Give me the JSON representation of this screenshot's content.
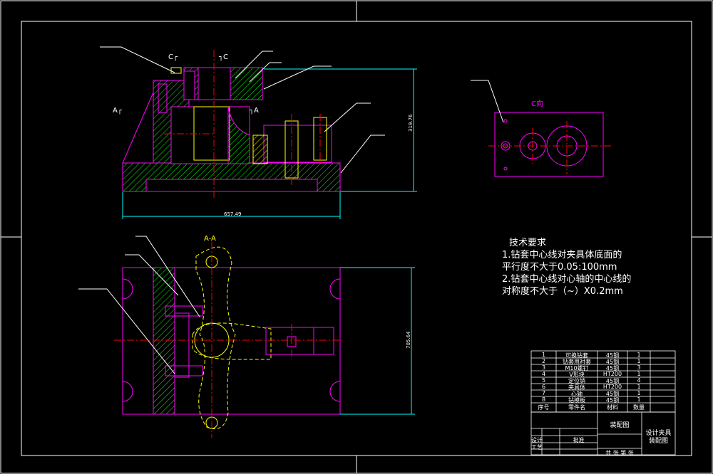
{
  "views": {
    "section_a": "A-A",
    "view_c": "C向",
    "mark_c_left": "C",
    "mark_c_right": "C",
    "mark_a_left": "A",
    "mark_a_right": "A"
  },
  "dimensions": {
    "width_top": "657.49",
    "height_top": "319.76",
    "height_bottom": "705.64"
  },
  "technical_requirements": {
    "title": "技术要求",
    "lines": [
      "1.钻套中心线对夹具体底面的",
      "平行度不大于0.05:100mm",
      "2.钻套中心线对心轴的中心线的",
      "对称度不大于（~）X0.2mm"
    ]
  },
  "parts_table": {
    "rows": [
      {
        "no": "1",
        "name": "可换钻套",
        "material": "45钢",
        "qty": "1"
      },
      {
        "no": "2",
        "name": "钻套用衬套",
        "material": "45钢",
        "qty": "1"
      },
      {
        "no": "3",
        "name": "M10螺钉",
        "material": "45钢",
        "qty": "3"
      },
      {
        "no": "4",
        "name": "V形块",
        "material": "HT200",
        "qty": "1"
      },
      {
        "no": "5",
        "name": "定位销",
        "material": "45钢",
        "qty": "4"
      },
      {
        "no": "6",
        "name": "夹具体",
        "material": "HT200",
        "qty": "1"
      },
      {
        "no": "7",
        "name": "心轴",
        "material": "45钢",
        "qty": "1"
      },
      {
        "no": "8",
        "name": "钻模板",
        "material": "45钢",
        "qty": "1"
      }
    ],
    "header": {
      "no": "序号",
      "name": "零件名",
      "material": "材料",
      "qty": "数量"
    }
  },
  "title_block": {
    "drawing_name": "装配图",
    "title_line1": "设计夹具",
    "title_line2": "装配图",
    "design": "设计",
    "process": "工艺",
    "approve": "批准",
    "sheet_row": "共 张 第 张"
  },
  "colors": {
    "frame": "#ffffff",
    "part_outline": "#ff00ff",
    "hatch": "#00ff00",
    "center_line": "#ff0000",
    "dimension": "#00ffff",
    "hidden_parts": "#ffff00"
  }
}
